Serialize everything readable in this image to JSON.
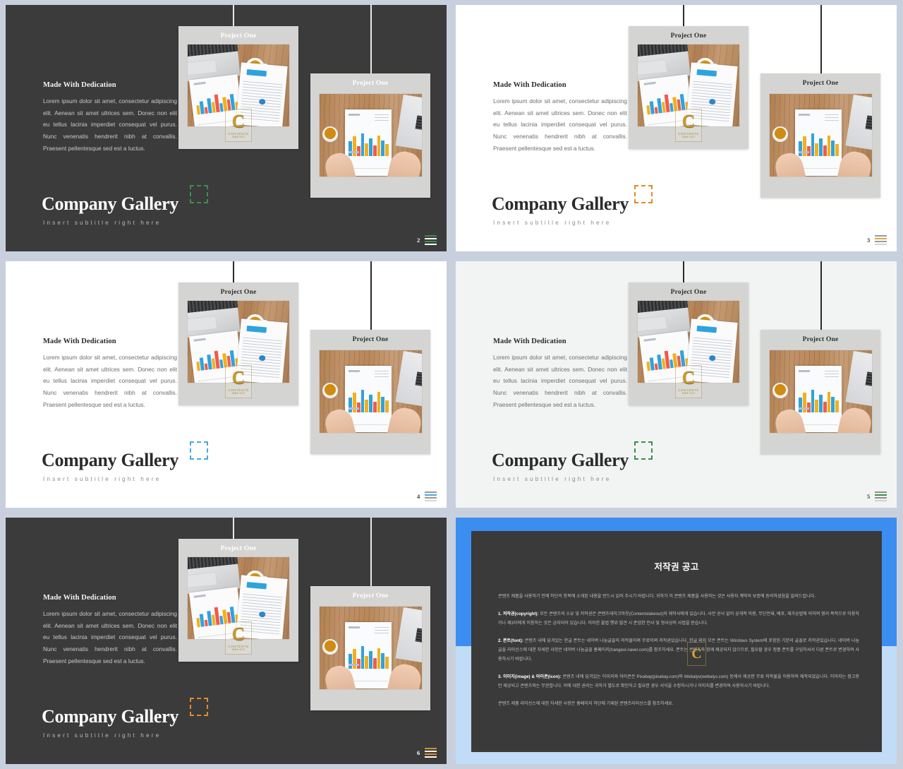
{
  "deck": {
    "slides": [
      {
        "id": "slide-2",
        "theme": "dark",
        "page_number": "2",
        "accent_color": "#3b8f4e",
        "burger_colors": [
          "#3b8f4e",
          "#ffffff",
          "#3b8f4e",
          "#ffffff"
        ],
        "heading": "Made With Dedication",
        "body": "Lorem ipsum dolor sit amet, consectetur adipiscing elit. Aenean sit amet ultrices sem. Donec non elit eu tellus lacinia imperdiet consequat vel purus. Nunc venenatis hendrerit nibh at convallis. Praesent pellentesque sed est a luctus.",
        "title": "Company Gallery",
        "subtitle": "Insert subtitle right here",
        "card_one_title": "Project One",
        "card_two_title": "Project One"
      },
      {
        "id": "slide-3",
        "theme": "light",
        "page_number": "3",
        "accent_color": "#e08c2a",
        "burger_colors": [
          "#8f8f8f",
          "#e0a44a",
          "#8f8f8f",
          "#c9c9c9"
        ],
        "heading": "Made With Dedication",
        "body": "Lorem ipsum dolor sit amet, consectetur adipiscing elit. Aenean sit amet ultrices sem. Donec non elit eu tellus lacinia imperdiet consequat vel purus. Nunc venenatis hendrerit nibh at convallis. Praesent pellentesque sed est a luctus.",
        "title": "Company Gallery",
        "subtitle": "Insert subtitle right here",
        "card_one_title": "Project One",
        "card_two_title": "Project One"
      },
      {
        "id": "slide-4",
        "theme": "light",
        "page_number": "4",
        "accent_color": "#4aa8e0",
        "burger_colors": [
          "#9a9a9a",
          "#4aa8e0",
          "#9a9a9a",
          "#cfcfcf"
        ],
        "heading": "Made With Dedication",
        "body": "Lorem ipsum dolor sit amet, consectetur adipiscing elit. Aenean sit amet ultrices sem. Donec non elit eu tellus lacinia imperdiet consequat vel purus. Nunc venenatis hendrerit nibh at convallis. Praesent pellentesque sed est a luctus.",
        "title": "Company Gallery",
        "subtitle": "Insert subtitle right here",
        "card_one_title": "Project One",
        "card_two_title": "Project One"
      },
      {
        "id": "slide-5",
        "theme": "light",
        "page_number": "5",
        "accent_color": "#3b8f4e",
        "burger_colors": [
          "#8f8f8f",
          "#3b8f4e",
          "#8f8f8f",
          "#cfcfcf"
        ],
        "heading": "Made With Dedication",
        "body": "Lorem ipsum dolor sit amet, consectetur adipiscing elit. Aenean sit amet ultrices sem. Donec non elit eu tellus lacinia imperdiet consequat vel purus. Nunc venenatis hendrerit nibh at convallis. Praesent pellentesque sed est a luctus.",
        "title": "Company Gallery",
        "subtitle": "Insert subtitle right here",
        "card_one_title": "Project One",
        "card_two_title": "Project One"
      },
      {
        "id": "slide-6",
        "theme": "dark",
        "page_number": "6",
        "accent_color": "#e08c2a",
        "burger_colors": [
          "#e08c2a",
          "#ffffff",
          "#e08c2a",
          "#ffffff"
        ],
        "heading": "Made With Dedication",
        "body": "Lorem ipsum dolor sit amet, consectetur adipiscing elit. Aenean sit amet ultrices sem. Donec non elit eu tellus lacinia imperdiet consequat vel purus. Nunc venenatis hendrerit nibh at convallis. Praesent pellentesque sed est a luctus.",
        "title": "Company Gallery",
        "subtitle": "Insert subtitle right here",
        "card_one_title": "Project One",
        "card_two_title": "Project One"
      }
    ]
  },
  "copyright_slide": {
    "title": "저작권 공고",
    "intro": "콘텐츠 제품을 사용하기 전에 하단의 항목에 소개된 내용을 반드시 읽어 주시기 바랍니다. 귀하가 이 콘텐츠 제품을 사용하는 것은 사용자 계약의 보증에 동의하셨음을 알려드립니다.",
    "section1_label": "1. 저작권(copyright):",
    "section1_text": " 모든 콘텐츠의 소유 및 저작권은 콘텐츠테이크아웃(Contentstakeout)의 제작사에게 있습니다. 사전 승낙 없이 공개적 이용, 무단전재, 배포, 재가공법에 의하여 영리 목적으로 이용하거나 제3자에게 이용하는 것은 금지되어 있습니다. 이러한 불법 행위 발견 시 준엄한 민사 및 형사상의 사법을 받습니다.",
    "section2_label": "2. 폰트(font):",
    "section2_text": " 콘텐츠 내에 담겨있는 한글 폰트는 네이버 나눔글꼴의 저작물이며 무료이며 저작권있습니다. 한글 외의 모든 폰트는 Windows System에 포함된 기본의 글꼴로 저작권있습니다. 네이버 나눔글꼴 라이선스에 대한 자세한 사항은 네이버 나눔글꼴 홈페이지(hangeul.naver.com)를 참조하세요. 폰트는 콘텐츠와 함께 제공되지 않으므로, 필요할 경우 정품 폰트를 구입하셔서 다른 폰트로 변경하여 사용하시기 바랍니다.",
    "section3_label": "3. 이미지(image) & 아이콘(icon):",
    "section3_text": " 콘텐츠 내에 담겨있는 이미지와 아이콘은 Pixabay(pixabay.com)와 Webalys(webalys.com) 등에서 제공한 무료 저작물을 이용하여 제작되었습니다. 이미지는 참고용만 제공되고 콘텐츠와는 무관합니다. 이에 대한 권리는 귀하가 별도로 확인하고 필요한 경우 서식을 수정하시거나 이미지를 변경하여 사용하시기 바랍니다.",
    "outro": "콘텐츠 제품 라이선스에 대한 자세한 사항은 홈페이지 하단에 기재된 콘텐츠라이선스를 참조하세요.",
    "watermark_letter": "C"
  },
  "watermark": {
    "letter": "C",
    "line1": "CONTENTS",
    "line2": "TAKE OUT"
  }
}
